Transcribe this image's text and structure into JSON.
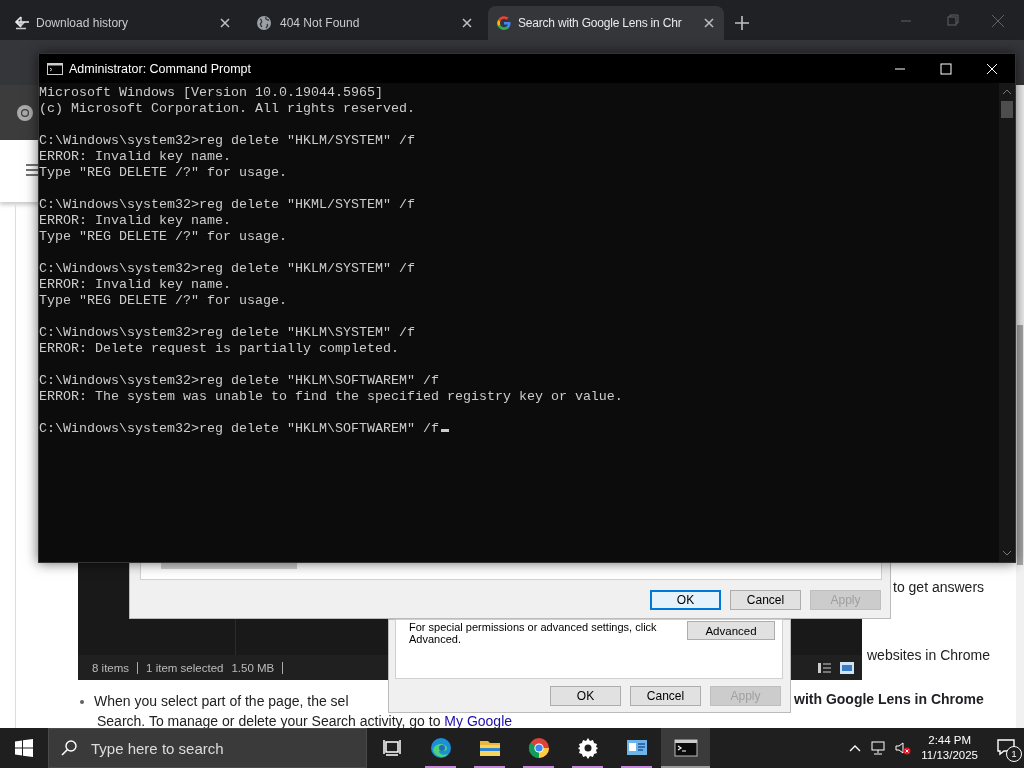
{
  "browser": {
    "tabs": [
      {
        "title": "Download history",
        "kind": "download",
        "selected": false
      },
      {
        "title": "404 Not Found",
        "kind": "globe",
        "selected": false
      },
      {
        "title": "Search with Google Lens in Chr",
        "kind": "google",
        "selected": true
      }
    ],
    "page": {
      "fragments": [
        {
          "kind": "text",
          "text": "to get answers"
        },
        {
          "kind": "text",
          "text": "websites in Chrome"
        },
        {
          "kind": "bullet",
          "text": "When you select part of the page, the sel"
        },
        {
          "kind": "heading",
          "text": "with Google Lens in Chrome"
        },
        {
          "kind": "link_line",
          "text": "Search. To manage or delete your Search activity, go to",
          "link": "My Google"
        }
      ]
    }
  },
  "explorer": {
    "status": [
      "8 items",
      "1 item selected",
      "1.50 MB"
    ]
  },
  "dialogs": [
    {
      "buttons": [
        {
          "label": "OK",
          "focused": true,
          "disabled": false
        },
        {
          "label": "Cancel",
          "focused": false,
          "disabled": false
        },
        {
          "label": "Apply",
          "focused": false,
          "disabled": true
        }
      ]
    },
    {
      "note": "For special permissions or advanced settings, click Advanced.",
      "advanced_button": "Advanced",
      "buttons": [
        {
          "label": "OK",
          "focused": false,
          "disabled": false
        },
        {
          "label": "Cancel",
          "focused": false,
          "disabled": false
        },
        {
          "label": "Apply",
          "focused": false,
          "disabled": true
        }
      ]
    }
  ],
  "console": {
    "title": "Administrator: Command Prompt",
    "cursor": true,
    "blocks": [
      [
        "Microsoft Windows [Version 10.0.19044.5965]",
        "(c) Microsoft Corporation. All rights reserved."
      ],
      [
        "C:\\Windows\\system32>reg delete \"HKLM/SYSTEM\" /f",
        "ERROR: Invalid key name.",
        "Type \"REG DELETE /?\" for usage."
      ],
      [
        "C:\\Windows\\system32>reg delete \"HKML/SYSTEM\" /f",
        "ERROR: Invalid key name.",
        "Type \"REG DELETE /?\" for usage."
      ],
      [
        "C:\\Windows\\system32>reg delete \"HKLM/SYSTEM\" /f",
        "ERROR: Invalid key name.",
        "Type \"REG DELETE /?\" for usage."
      ],
      [
        "C:\\Windows\\system32>reg delete \"HKLM\\SYSTEM\" /f",
        "ERROR: Delete request is partially completed."
      ],
      [
        "C:\\Windows\\system32>reg delete \"HKLM\\SOFTWAREM\" /f",
        "ERROR: The system was unable to find the specified registry key or value."
      ],
      [
        "C:\\Windows\\system32>reg delete \"HKLM\\SOFTWAREM\" /f"
      ]
    ]
  },
  "taskbar": {
    "search_placeholder": "Type here to search",
    "apps": [
      {
        "kind": "task-view",
        "running": false,
        "selected": false
      },
      {
        "kind": "edge",
        "running": true,
        "selected": false
      },
      {
        "kind": "explorer",
        "running": true,
        "selected": false
      },
      {
        "kind": "chrome",
        "running": true,
        "selected": false
      },
      {
        "kind": "settings",
        "running": true,
        "selected": false
      },
      {
        "kind": "control-panel",
        "running": true,
        "selected": false
      },
      {
        "kind": "terminal",
        "running": true,
        "selected": true
      }
    ],
    "clock": {
      "time": "2:44 PM",
      "date": "11/13/2025"
    },
    "notifications": "1"
  }
}
